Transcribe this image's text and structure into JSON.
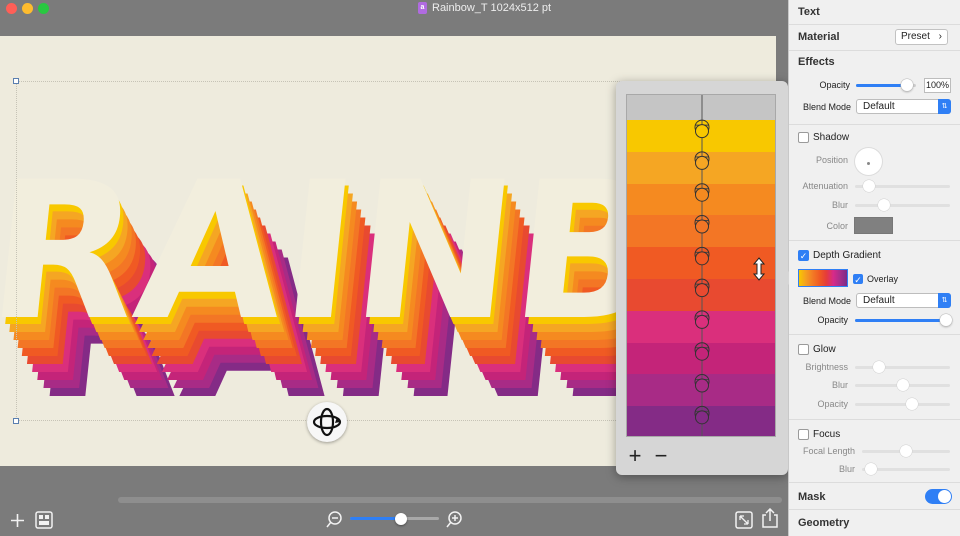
{
  "window": {
    "title": "Rainbow_T 1024x512 pt"
  },
  "canvas": {
    "artwork_text": "RAINBOW"
  },
  "depth_gradient_editor": {
    "stop_colors": [
      "#f8c800",
      "#f5a623",
      "#f58a20",
      "#f37625",
      "#f05a23",
      "#e84a30",
      "#da2f7c",
      "#c42479",
      "#a82b86",
      "#842b86"
    ],
    "add_label": "+",
    "remove_label": "−"
  },
  "inspector": {
    "sections": {
      "text": "Text",
      "material": "Material",
      "effects": "Effects",
      "mask": "Mask",
      "geometry": "Geometry"
    },
    "material": {
      "preset_label": "Preset"
    },
    "effects": {
      "opacity_label": "Opacity",
      "opacity_value": "100%",
      "opacity_level": 0.85,
      "blend_mode_label": "Blend Mode",
      "blend_mode_value": "Default"
    },
    "shadow": {
      "label": "Shadow",
      "checked": false,
      "position_label": "Position",
      "attenuation_label": "Attenuation",
      "attenuation_level": 0.15,
      "blur_label": "Blur",
      "blur_level": 0.3,
      "color_label": "Color",
      "color": "#808080"
    },
    "depth_gradient": {
      "label": "Depth Gradient",
      "checked": true,
      "overlay_label": "Overlay",
      "overlay_checked": true,
      "blend_mode_label": "Blend Mode",
      "blend_mode_value": "Default",
      "opacity_label": "Opacity",
      "opacity_level": 0.97
    },
    "glow": {
      "label": "Glow",
      "checked": false,
      "brightness_label": "Brightness",
      "brightness_level": 0.25,
      "blur_label": "Blur",
      "blur_level": 0.5,
      "opacity_label": "Opacity",
      "opacity_level": 0.6
    },
    "focus": {
      "label": "Focus",
      "checked": false,
      "focal_length_label": "Focal Length",
      "focal_length_level": 0.5,
      "blur_label": "Blur",
      "blur_level": 0.1
    },
    "mask_enabled": true
  },
  "toolbar": {
    "zoom_level": 0.57
  },
  "colors": {
    "accent": "#2f7ff5",
    "canvas_bg": "#eeebdd",
    "chrome": "#7b7b7b"
  }
}
